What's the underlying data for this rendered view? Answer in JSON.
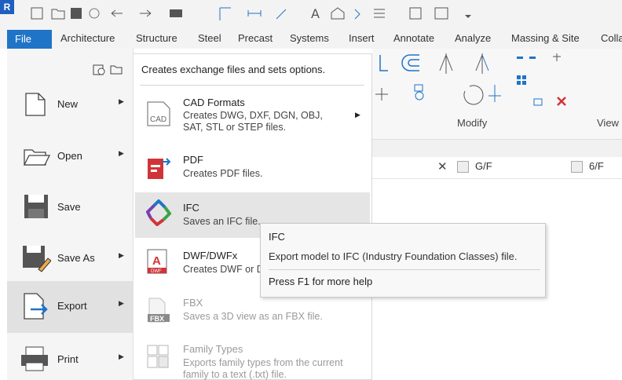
{
  "app": {
    "logo_letter": "R"
  },
  "ribbon_tabs": [
    "File",
    "Architecture",
    "Structure",
    "Steel",
    "Precast",
    "Systems",
    "Insert",
    "Annotate",
    "Analyze",
    "Massing & Site",
    "Colla"
  ],
  "ribbon": {
    "modify_label": "Modify",
    "view_label": "View"
  },
  "view_tabs": [
    {
      "label": "G/F",
      "closable": true
    },
    {
      "label": "6/F",
      "closable": false
    }
  ],
  "file_menu": {
    "items": [
      {
        "label": "New",
        "icon": "new-file-icon",
        "has_arrow": true
      },
      {
        "label": "Open",
        "icon": "folder-icon",
        "has_arrow": true
      },
      {
        "label": "Save",
        "icon": "floppy-icon",
        "has_arrow": false
      },
      {
        "label": "Save As",
        "icon": "save-as-icon",
        "has_arrow": true
      },
      {
        "label": "Export",
        "icon": "export-icon",
        "has_arrow": true,
        "active": true
      },
      {
        "label": "Print",
        "icon": "printer-icon",
        "has_arrow": true
      }
    ]
  },
  "export_submenu": {
    "header": "Creates exchange files and sets options.",
    "items": [
      {
        "title": "CAD Formats",
        "desc": [
          "Creates DWG, DXF, DGN, OBJ,",
          "SAT, STL or STEP files."
        ],
        "icon": "cad-icon",
        "has_arrow": true
      },
      {
        "title": "PDF",
        "desc": [
          "Creates PDF files."
        ],
        "icon": "pdf-icon"
      },
      {
        "title": "IFC",
        "desc": [
          "Saves an IFC file."
        ],
        "icon": "ifc-icon",
        "hover": true
      },
      {
        "title": "DWF/DWFx",
        "desc": [
          "Creates DWF or D"
        ],
        "icon": "dwf-icon"
      },
      {
        "title": "FBX",
        "desc": [
          "Saves a 3D view as an FBX file."
        ],
        "icon": "fbx-icon",
        "disabled": true
      },
      {
        "title": "Family Types",
        "desc": [
          "Exports family types from the current",
          "family to a text (.txt) file."
        ],
        "icon": "family-types-icon",
        "disabled": true
      }
    ],
    "icon_badges": {
      "cad": "CAD",
      "dwf": "DWF",
      "fbx": "FBX",
      "dwf_letter": "A"
    }
  },
  "tooltip": {
    "title": "IFC",
    "description": "Export model to IFC (Industry Foundation Classes) file.",
    "help": "Press F1 for more help"
  },
  "colors": {
    "file_tab": "#1f74c8",
    "accent_red": "#d13438",
    "accent_blue": "#1f74c8"
  }
}
